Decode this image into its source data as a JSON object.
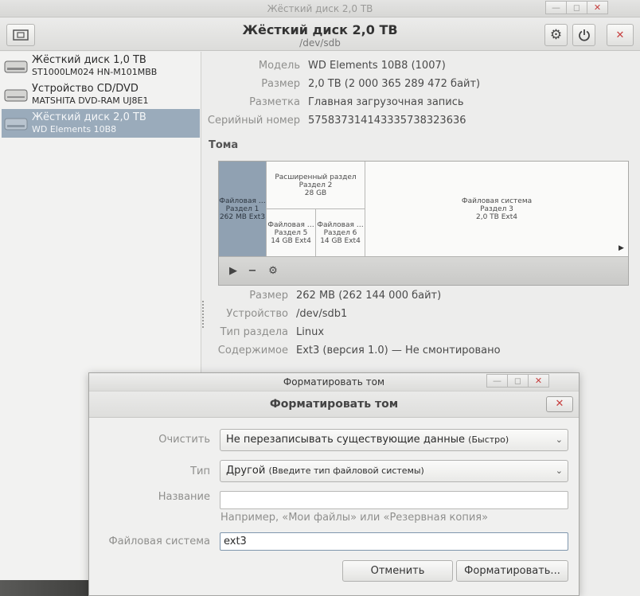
{
  "main_window": {
    "title": "Жёсткий диск 2,0 TB",
    "header_title": "Жёсткий диск 2,0 TB",
    "header_subtitle": "/dev/sdb"
  },
  "sidebar": {
    "items": [
      {
        "name": "Жёсткий диск 1,0 TB",
        "model": "ST1000LM024 HN-M101MBB",
        "selected": false
      },
      {
        "name": "Устройство CD/DVD",
        "model": "MATSHITA DVD-RAM UJ8E1",
        "selected": false
      },
      {
        "name": "Жёсткий диск 2,0 TB",
        "model": "WD Elements 10B8",
        "selected": true
      }
    ]
  },
  "drive_props": [
    {
      "label": "Модель",
      "value": "WD Elements 10B8 (1007)"
    },
    {
      "label": "Размер",
      "value": "2,0 TB (2 000 365 289 472 байт)"
    },
    {
      "label": "Разметка",
      "value": "Главная загрузочная запись"
    },
    {
      "label": "Серийный номер",
      "value": "575837314143335738323636"
    }
  ],
  "volumes": {
    "heading": "Тома",
    "partitions": [
      {
        "l1": "Файловая …",
        "l2": "Раздел 1",
        "l3": "262 MB Ext3",
        "selected": true
      },
      {
        "l1": "Расширенный раздел",
        "l2": "Раздел 2",
        "l3": "28 GB"
      },
      {
        "l1": "Файловая …",
        "l2": "Раздел 5",
        "l3": "14 GB Ext4"
      },
      {
        "l1": "Файловая …",
        "l2": "Раздел 6",
        "l3": "14 GB Ext4"
      },
      {
        "l1": "Файловая система",
        "l2": "Раздел 3",
        "l3": "2,0 TB Ext4"
      }
    ]
  },
  "volume_props": [
    {
      "label": "Размер",
      "value": "262 MB (262 144 000 байт)"
    },
    {
      "label": "Устройство",
      "value": "/dev/sdb1"
    },
    {
      "label": "Тип раздела",
      "value": "Linux"
    },
    {
      "label": "Содержимое",
      "value": "Ext3 (версия 1.0) — Не смонтировано"
    }
  ],
  "dialog": {
    "title": "Форматировать том",
    "header": "Форматировать том",
    "erase_label": "Очистить",
    "erase_main": "Не перезаписывать существующие данные",
    "erase_note": "(Быстро)",
    "type_label": "Тип",
    "type_main": "Другой",
    "type_note": "(Введите тип файловой системы)",
    "name_label": "Название",
    "name_value": "",
    "name_hint": "Например, «Мои файлы» или «Резервная копия»",
    "fs_label": "Файловая система",
    "fs_value": "ext3",
    "cancel_label": "Отменить",
    "format_label": "Форматировать..."
  },
  "colors": {
    "selection": "#9aabbb",
    "close": "#c74040"
  }
}
